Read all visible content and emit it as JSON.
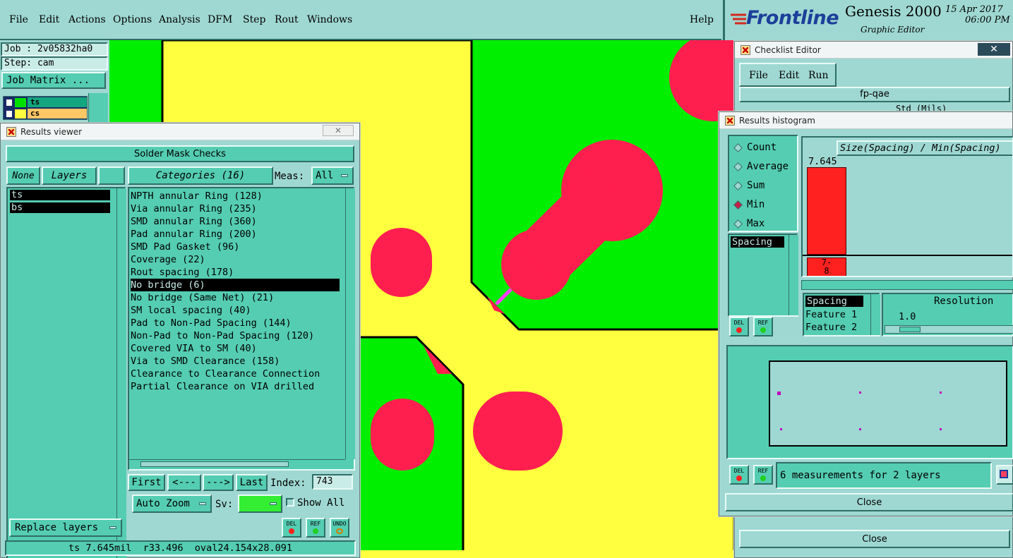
{
  "menubar": {
    "items": [
      "File",
      "Edit",
      "Actions",
      "Options",
      "Analysis",
      "DFM",
      "Step",
      "Rout",
      "Windows"
    ],
    "help": "Help"
  },
  "brand": {
    "logo": "Frontline",
    "product": "Genesis 2000",
    "subtitle": "Graphic Editor",
    "date": "15 Apr 2017",
    "time": "06:00 PM"
  },
  "leftpanel": {
    "job": "Job : 2v05832ha0",
    "step": "Step: cam",
    "job_matrix": "Job Matrix ...",
    "layers": [
      "ts",
      "cs"
    ]
  },
  "results_viewer": {
    "title": "Results viewer",
    "heading": "Solder Mask Checks",
    "none_btn": "None",
    "layers_btn": "Layers",
    "categories_btn": "Categories (16)",
    "meas_label": "Meas:",
    "meas_value": "All",
    "layer_list": [
      "ts",
      "bs"
    ],
    "categories": [
      "NPTH annular Ring (128)",
      "Via annular Ring (235)",
      "SMD annular Ring (360)",
      "Pad annular Ring (200)",
      "SMD Pad Gasket (96)",
      "Coverage (22)",
      "Rout spacing (178)",
      "No bridge (6)",
      "No bridge (Same Net) (21)",
      "SM local spacing (40)",
      "Pad to Non-Pad Spacing (144)",
      "Non-Pad to Non-Pad Spacing (120)",
      "Covered VIA to SM (40)",
      "Via to SMD Clearance (158)",
      "Clearance to Clearance Connection",
      "Partial Clearance on VIA drilled"
    ],
    "selected_category": "No bridge (6)",
    "first": "First",
    "prev": "<---",
    "next": "--->",
    "last": "Last",
    "index_label": "Index:",
    "index_value": "743",
    "zoom": "Auto Zoom",
    "sv_label": "Sv:",
    "show_all": "Show All",
    "replace_layers": "Replace layers",
    "del": "DEL",
    "ref": "REF",
    "undo": "UNDO",
    "status": "ts 7.645mil  r33.496  oval24.154x28.091"
  },
  "checklist": {
    "title": "Checklist Editor",
    "menu": [
      "File",
      "Edit",
      "Run"
    ],
    "name": "fp-qae",
    "units": "Std (Mils)",
    "close": "Close"
  },
  "histogram": {
    "title": "Results histogram",
    "modes": [
      "Count",
      "Average",
      "Sum",
      "Min",
      "Max"
    ],
    "selected_mode": "Min",
    "measure_list": [
      "Spacing"
    ],
    "chart_title": "Size(Spacing) / Min(Spacing)",
    "bar_value": "7.645",
    "bar_label": "7-\n8",
    "attributes": [
      "Spacing",
      "Feature 1",
      "Feature 2"
    ],
    "resolution_label": "Resolution",
    "resolution_value": "1.0",
    "del": "DEL",
    "ref": "REF",
    "summary": "6 measurements for 2 layers",
    "close": "Close"
  },
  "colors": {
    "background": "#9fd8d2",
    "panel": "#55cdb2",
    "copper_yellow": "#ffff3f",
    "mask_green": "#00ee00",
    "pad_red": "#ff1f4f",
    "highlight_magenta": "#ff3cff"
  }
}
